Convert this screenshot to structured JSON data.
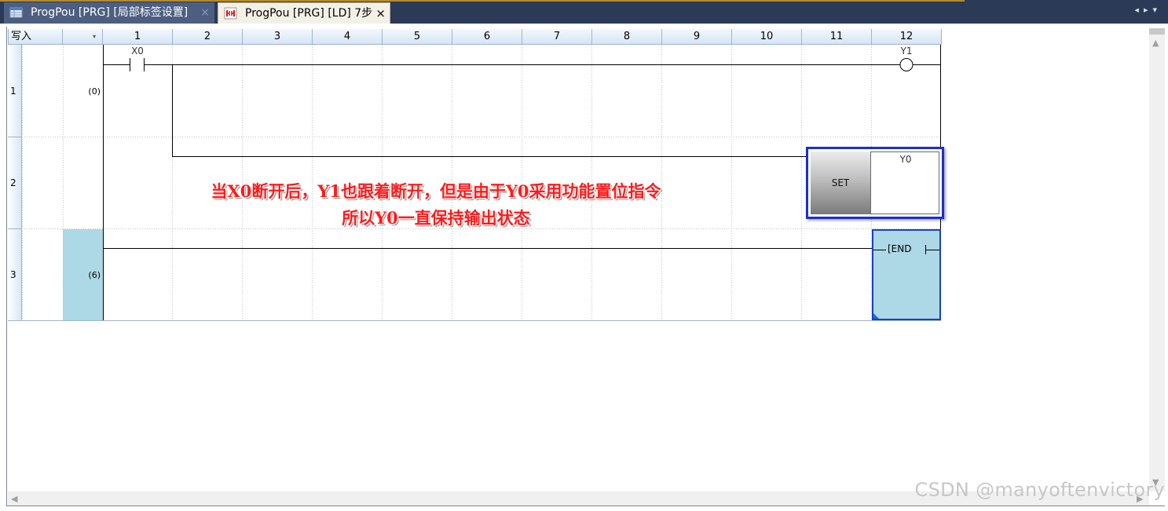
{
  "tabs": [
    {
      "label": "ProgPou [PRG] [局部标签设置]",
      "close": "×",
      "active": false,
      "icon": "label-table-icon"
    },
    {
      "label": "ProgPou [PRG] [LD] 7步",
      "close": "×",
      "active": true,
      "icon": "ladder-icon"
    }
  ],
  "nav": {
    "left": "◂",
    "right": "▸",
    "menu": "▾"
  },
  "header": {
    "mode": "写入",
    "dropdown": "▾",
    "columns": [
      "1",
      "2",
      "3",
      "4",
      "5",
      "6",
      "7",
      "8",
      "9",
      "10",
      "11",
      "12"
    ]
  },
  "rows": [
    {
      "number": "1",
      "step": "(0)"
    },
    {
      "number": "2",
      "step": ""
    },
    {
      "number": "3",
      "step": "(6)"
    }
  ],
  "ladder": {
    "contact_x0": "X0",
    "coil_y1": "Y1",
    "set_instruction": "SET",
    "set_device": "Y0",
    "end_instruction": "[END"
  },
  "annotation": {
    "line1": "当X0断开后，Y1也跟着断开，但是由于Y0采用功能置位指令",
    "line2": "所以Y0一直保持输出状态"
  },
  "scroll": {
    "up": "▲",
    "down": "▼",
    "left": "◀",
    "right": "▶"
  },
  "watermark": "CSDN @manyoftenvictory",
  "colors": {
    "selection": "#add8e6",
    "cursor_border": "#1a2fd0",
    "annotation": "#ff1a1a"
  }
}
